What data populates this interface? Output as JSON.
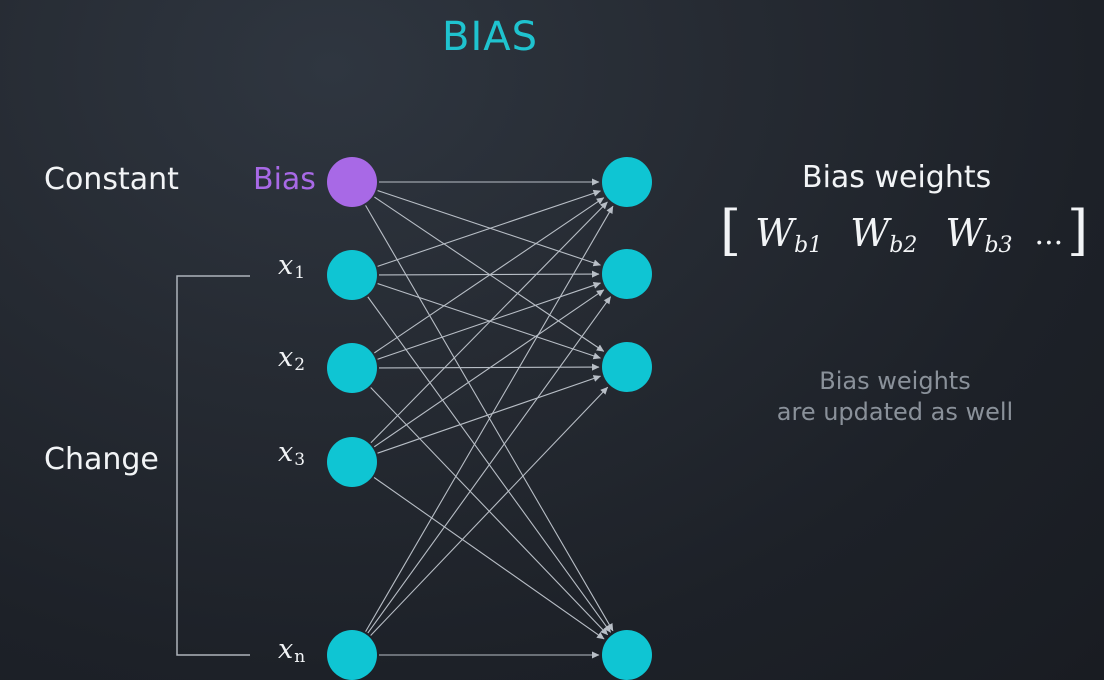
{
  "title": "BIAS",
  "labels": {
    "constant": "Constant",
    "change": "Change",
    "bias": "Bias"
  },
  "inputs": [
    {
      "symbol": "x",
      "subscript": "1"
    },
    {
      "symbol": "x",
      "subscript": "2"
    },
    {
      "symbol": "x",
      "subscript": "3"
    },
    {
      "symbol": "x",
      "subscript": "n"
    }
  ],
  "bias_weights": {
    "title": "Bias weights",
    "terms": [
      {
        "symbol": "W",
        "subscript": "b1"
      },
      {
        "symbol": "W",
        "subscript": "b2"
      },
      {
        "symbol": "W",
        "subscript": "b3"
      }
    ],
    "ellipsis": "...",
    "open_bracket": "[",
    "close_bracket": "]"
  },
  "note": {
    "line1": "Bias weights",
    "line2": "are updated as well"
  },
  "colors": {
    "title": "#1fc3cf",
    "node": "#0fc5d3",
    "bias_node": "#a869e6",
    "arrow": "#b8bec6",
    "bracket_line": "#aeb4bb"
  },
  "icons": {
    "node": "filled-circle",
    "arrow": "arrowhead"
  }
}
